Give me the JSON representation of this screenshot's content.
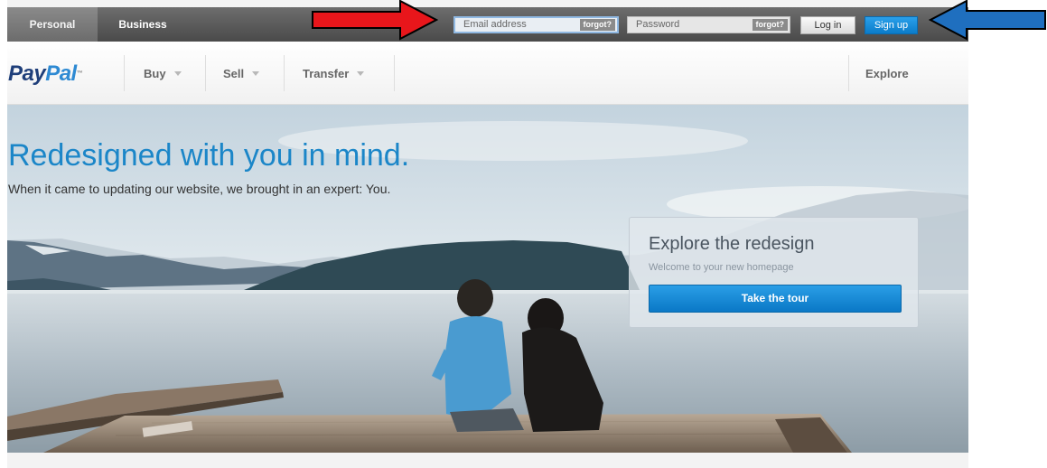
{
  "top_bar": {
    "tabs": [
      {
        "label": "Personal",
        "active": true
      },
      {
        "label": "Business",
        "active": false
      }
    ],
    "email": {
      "placeholder": "Email address",
      "forgot_label": "forgot?"
    },
    "password": {
      "placeholder": "Password",
      "forgot_label": "forgot?"
    },
    "login_label": "Log in",
    "signup_label": "Sign up"
  },
  "nav": {
    "logo": {
      "pay": "Pay",
      "pal": "Pal"
    },
    "items": [
      {
        "label": "Buy"
      },
      {
        "label": "Sell"
      },
      {
        "label": "Transfer"
      }
    ],
    "explore_label": "Explore"
  },
  "hero": {
    "headline": "Redesigned with you in mind.",
    "subline": "When it came to updating our website, we brought in an expert: You."
  },
  "promo": {
    "title": "Explore the redesign",
    "subtitle": "Welcome to your new homepage",
    "button_label": "Take the tour"
  },
  "annotations": [
    {
      "color": "#e8161b",
      "icon": "arrow-right-icon"
    },
    {
      "color": "#1f6fbf",
      "icon": "arrow-left-icon"
    }
  ],
  "colors": {
    "brand_blue": "#1b86c8",
    "button_blue": "#0b7cc9",
    "top_bar": "#555555"
  }
}
